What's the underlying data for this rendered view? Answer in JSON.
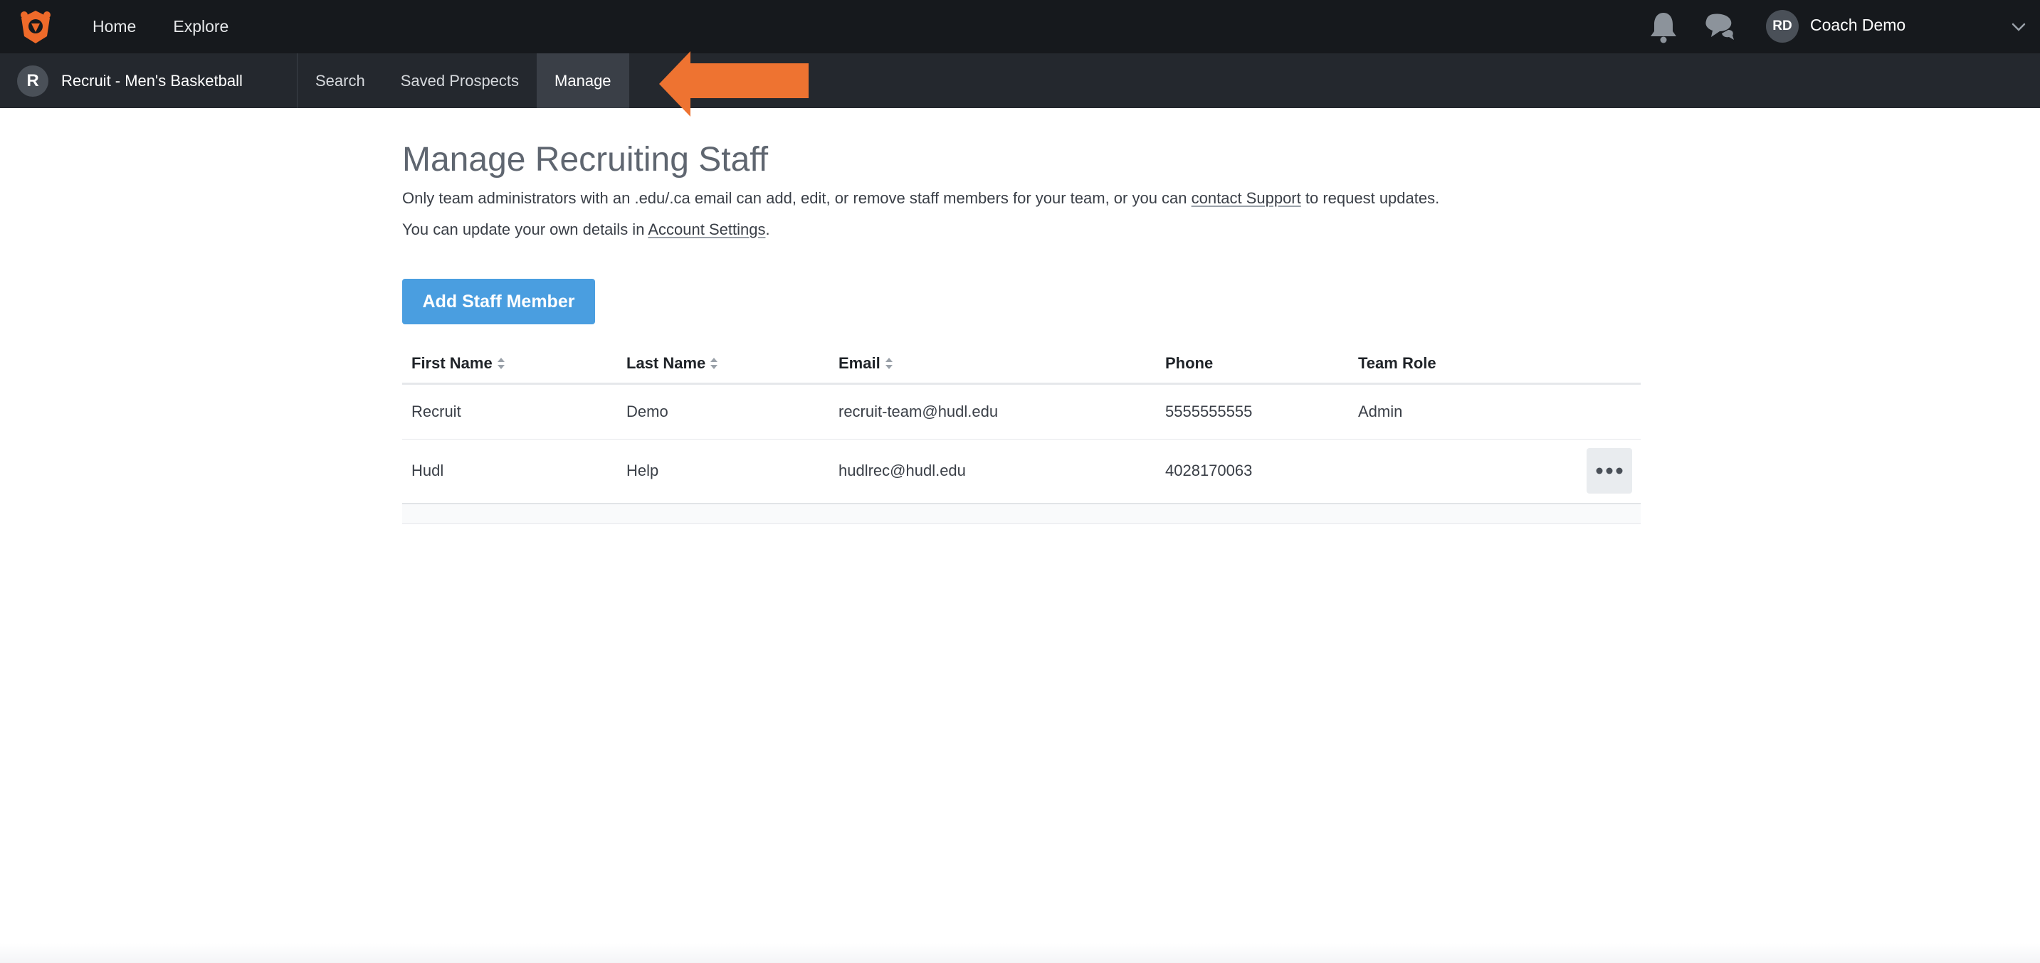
{
  "topbar": {
    "nav": [
      {
        "label": "Home"
      },
      {
        "label": "Explore"
      }
    ],
    "user": {
      "initials": "RD",
      "name": "Coach Demo"
    }
  },
  "subbar": {
    "team_initial": "R",
    "team_name": "Recruit - Men's Basketball",
    "tabs": [
      {
        "label": "Search"
      },
      {
        "label": "Saved Prospects"
      },
      {
        "label": "Manage",
        "active": true
      }
    ]
  },
  "page": {
    "title": "Manage Recruiting Staff",
    "desc_before": "Only team administrators with an .edu/.ca email can add, edit, or remove staff members for your team, or you can ",
    "desc_link": "contact Support",
    "desc_after": " to request updates.",
    "desc2_before": "You can update your own details in ",
    "desc2_link": "Account Settings",
    "desc2_after": ".",
    "add_button": "Add Staff Member"
  },
  "table": {
    "headers": [
      "First Name",
      "Last Name",
      "Email",
      "Phone",
      "Team Role"
    ],
    "rows": [
      {
        "first": "Recruit",
        "last": "Demo",
        "email": "recruit-team@hudl.edu",
        "phone": "5555555555",
        "role": "Admin"
      },
      {
        "first": "Hudl",
        "last": "Help",
        "email": "hudlrec@hudl.edu",
        "phone": "4028170063",
        "role": ""
      }
    ]
  },
  "colors": {
    "accent": "#4a9ee0",
    "brand_orange": "#ee6a2a",
    "topbar": "#16191d",
    "subbar": "#24282e"
  },
  "icons": [
    "hudl-logo-icon",
    "bell-icon",
    "chat-icon",
    "chevron-down-icon",
    "sort-icon",
    "more-icon",
    "arrow-annotation"
  ]
}
